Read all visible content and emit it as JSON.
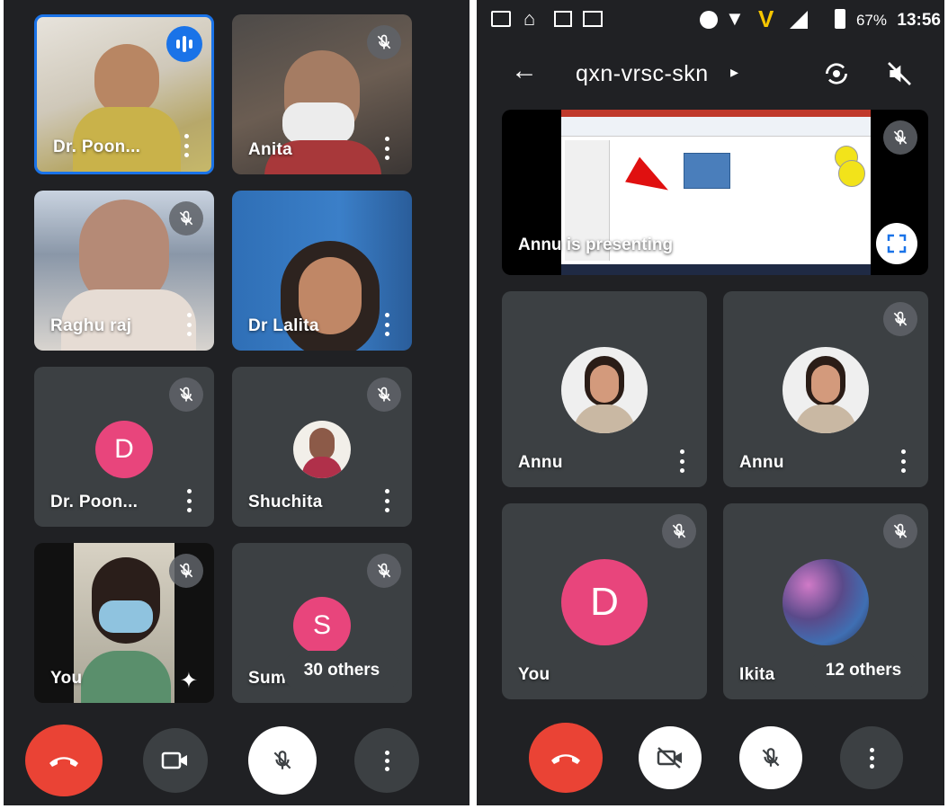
{
  "left_screen": {
    "tiles": [
      {
        "name": "Dr. Poon...",
        "state": "speaking"
      },
      {
        "name": "Anita",
        "state": "muted"
      },
      {
        "name": "Raghu raj",
        "state": "muted"
      },
      {
        "name": "Dr Lalita",
        "state": "unmuted"
      },
      {
        "name": "Dr. Poon...",
        "state": "muted",
        "avatar_letter": "D"
      },
      {
        "name": "Shuchita",
        "state": "muted"
      },
      {
        "name": "You",
        "state": "muted"
      },
      {
        "name": "Suma",
        "state": "muted",
        "avatar_letter": "S"
      }
    ],
    "others_chip": "30 others",
    "controls": [
      "end-call",
      "camera",
      "mic-off",
      "more"
    ]
  },
  "right_screen": {
    "status_bar": {
      "battery": "67%",
      "time": "13:56"
    },
    "app_bar": {
      "meeting_code": "qxn-vrsc-skn"
    },
    "presentation": {
      "label": "Annu is presenting"
    },
    "tiles": [
      {
        "name": "Annu",
        "state": "unmuted"
      },
      {
        "name": "Annu",
        "state": "muted"
      },
      {
        "name": "You",
        "state": "muted",
        "avatar_letter": "D"
      },
      {
        "name": "Ikita",
        "state": "muted"
      }
    ],
    "others_chip": "12 others",
    "controls": [
      "end-call",
      "camera-off",
      "mic-off",
      "more"
    ]
  },
  "colors": {
    "background": "#202124",
    "tile": "#3c4043",
    "end_call": "#ea4335",
    "avatar_pink": "#e8457c",
    "speaking_blue": "#1a73e8"
  }
}
